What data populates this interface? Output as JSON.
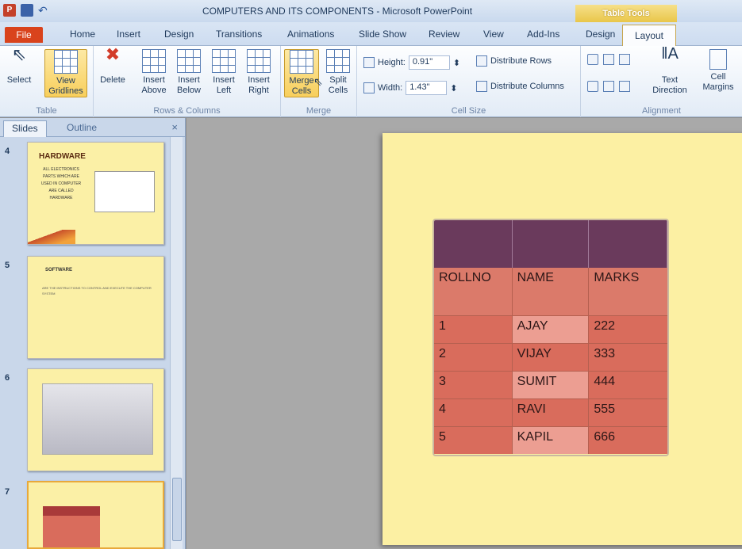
{
  "window": {
    "title": "COMPUTERS AND ITS COMPONENTS - Microsoft PowerPoint",
    "context_tab": "Table Tools"
  },
  "tabs": [
    "File",
    "Home",
    "Insert",
    "Design",
    "Transitions",
    "Animations",
    "Slide Show",
    "Review",
    "View",
    "Add-Ins",
    "Design",
    "Layout"
  ],
  "ribbon": {
    "table_group": {
      "label": "Table",
      "select": "Select",
      "view_gridlines": "View Gridlines"
    },
    "rows_cols_group": {
      "label": "Rows & Columns",
      "delete": "Delete",
      "insert_above": "Insert Above",
      "insert_below": "Insert Below",
      "insert_left": "Insert Left",
      "insert_right": "Insert Right"
    },
    "merge_group": {
      "label": "Merge",
      "merge": "Merge Cells",
      "split": "Split Cells"
    },
    "cellsize_group": {
      "label": "Cell Size",
      "height_label": "Height:",
      "height_value": "0.91\"",
      "width_label": "Width:",
      "width_value": "1.43\"",
      "dist_rows": "Distribute Rows",
      "dist_cols": "Distribute Columns"
    },
    "alignment_group": {
      "label": "Alignment",
      "text_direction": "Text Direction",
      "cell_margins": "Cell Margins"
    }
  },
  "panel": {
    "slides_tab": "Slides",
    "outline_tab": "Outline",
    "close": "×"
  },
  "thumbnails": [
    {
      "num": "4",
      "title": "HARDWARE",
      "body": "ALL ELECTRONICS PARTS WHICH ARE USED IN COMPUTER ARE CALLED HARDWARE"
    },
    {
      "num": "5",
      "title": "SOFTWARE",
      "body": "ARE THE INSTRUCTIONS TO CONTROL AND EXECUTE THE COMPUTER SYSTEM"
    },
    {
      "num": "6",
      "title": "",
      "body": ""
    },
    {
      "num": "7",
      "title": "",
      "body": ""
    }
  ],
  "table": {
    "headers": [
      "ROLLNO",
      "NAME",
      "MARKS"
    ],
    "rows": [
      [
        "1",
        "AJAY",
        "222"
      ],
      [
        "2",
        "VIJAY",
        "333"
      ],
      [
        "3",
        "SUMIT",
        "444"
      ],
      [
        "4",
        "RAVI",
        "555"
      ],
      [
        "5",
        "KAPIL",
        "666"
      ]
    ]
  }
}
